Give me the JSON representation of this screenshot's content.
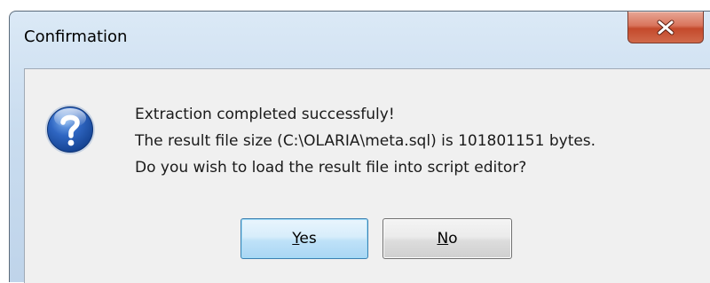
{
  "dialog": {
    "title": "Confirmation",
    "close_icon": "close-icon",
    "question_icon": "question-icon",
    "message_lines": [
      "Extraction completed successfuly!",
      "The result file size (C:\\OLARIA\\meta.sql) is 101801151 bytes.",
      "Do you wish to load the result file into script editor?"
    ],
    "buttons": {
      "yes_mnemonic": "Y",
      "yes_rest": "es",
      "no_mnemonic": "N",
      "no_rest": "o"
    },
    "colors": {
      "close_button": "#c8512f",
      "icon_blue": "#2b5ba8",
      "default_button_border": "#3c7fb1"
    }
  }
}
